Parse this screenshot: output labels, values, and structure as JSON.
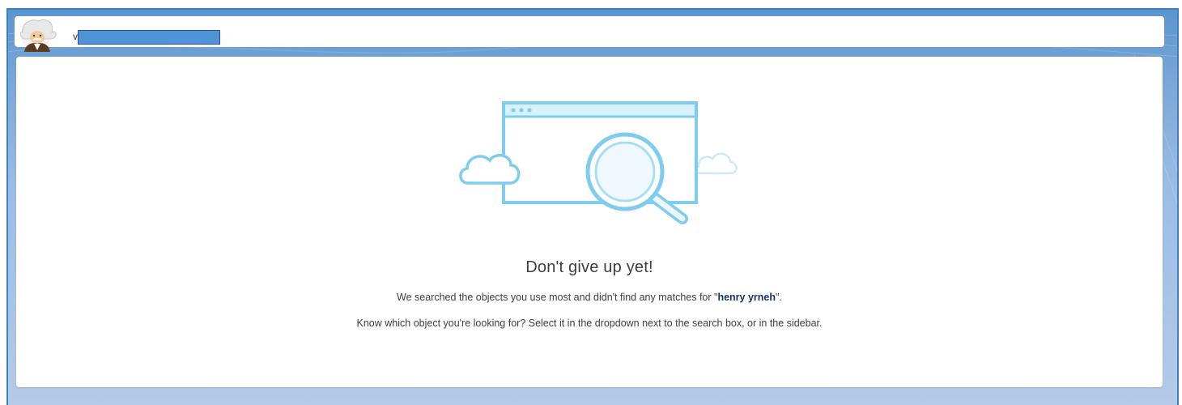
{
  "header": {
    "prefix": "v",
    "avatar_icon": "einstein-avatar-icon"
  },
  "empty_state": {
    "illustration_icon": "search-window-illustration-icon",
    "heading": "Don't give up yet!",
    "line1_before": "We searched the objects you use most and didn't find any matches for \"",
    "query": "henry yrneh",
    "line1_after": "\".",
    "line2": "Know which object you're looking for? Select it in the dropdown next to the search box, or in the sidebar."
  },
  "colors": {
    "frame_blue": "#5b95cf",
    "illustration_blue": "#7fcdee",
    "redaction_blue": "#4f93d8"
  }
}
